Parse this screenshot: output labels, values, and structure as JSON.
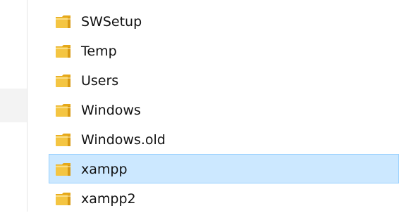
{
  "file_list": {
    "items": [
      {
        "name": "SWSetup",
        "icon": "folder-icon",
        "selected": false
      },
      {
        "name": "Temp",
        "icon": "folder-icon",
        "selected": false
      },
      {
        "name": "Users",
        "icon": "folder-icon",
        "selected": false
      },
      {
        "name": "Windows",
        "icon": "folder-icon",
        "selected": false
      },
      {
        "name": "Windows.old",
        "icon": "folder-icon",
        "selected": false
      },
      {
        "name": "xampp",
        "icon": "folder-icon",
        "selected": true
      },
      {
        "name": "xampp2",
        "icon": "folder-icon",
        "selected": false
      }
    ]
  },
  "colors": {
    "selection_background": "#cce8ff",
    "selection_border": "#99d1ff",
    "folder_yellow": "#f4c542",
    "folder_tab": "#e5a81a"
  }
}
